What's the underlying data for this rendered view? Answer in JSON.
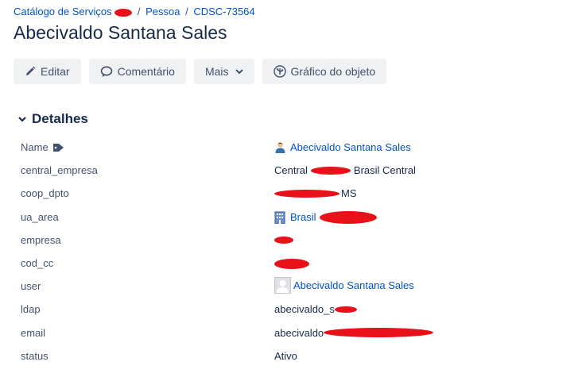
{
  "breadcrumb": {
    "items": [
      "Catálogo de Serviços",
      "Pessoa",
      "CDSC-73564"
    ],
    "separator": "/"
  },
  "page": {
    "title": "Abecivaldo Santana Sales"
  },
  "toolbar": {
    "edit_label": "Editar",
    "comment_label": "Comentário",
    "more_label": "Mais",
    "graph_label": "Gráfico do objeto"
  },
  "details": {
    "section_title": "Detalhes",
    "rows": [
      {
        "key": "Name",
        "value": "Abecivaldo Santana Sales"
      },
      {
        "key": "central_empresa",
        "value_prefix": "Central",
        "value_suffix": "Brasil Central"
      },
      {
        "key": "coop_dpto",
        "value_suffix": "MS"
      },
      {
        "key": "ua_area",
        "value": "Brasil"
      },
      {
        "key": "empresa"
      },
      {
        "key": "cod_cc"
      },
      {
        "key": "user",
        "value": "Abecivaldo Santana Sales"
      },
      {
        "key": "ldap",
        "value_prefix": "abecivaldo_s"
      },
      {
        "key": "email",
        "value_prefix": "abecivaldo"
      },
      {
        "key": "status",
        "value": "Ativo"
      }
    ]
  },
  "colors": {
    "link": "#0052cc",
    "text": "#172b4d",
    "muted": "#42526e",
    "button_bg": "#f0f1f3",
    "redaction": "#e8111a"
  },
  "icons": [
    "pencil-icon",
    "speech-bubble-icon",
    "chevron-down-icon",
    "graph-icon",
    "tag-icon",
    "person-icon",
    "building-icon",
    "avatar-placeholder-icon"
  ]
}
